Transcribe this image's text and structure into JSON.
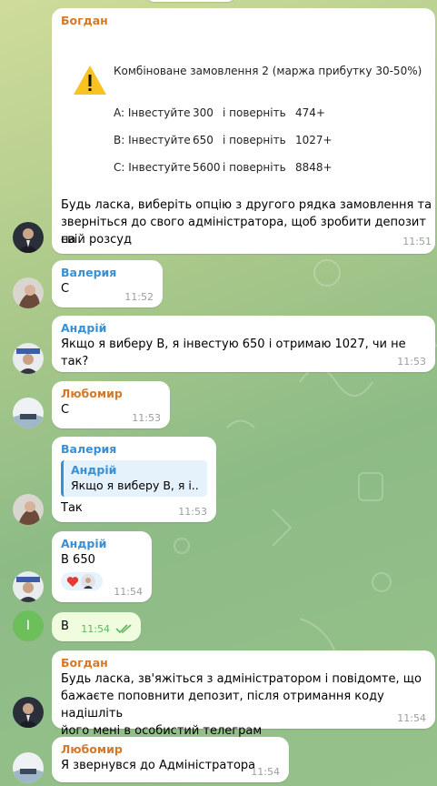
{
  "colors": {
    "bogdan": "#d27a2a",
    "valeria": "#3a8fd2",
    "andriy": "#3a8fd2",
    "lubomyr": "#d27a2a",
    "check": "#61b55d"
  },
  "m1": {
    "sender": "Богдан",
    "offer_title": "Комбіноване замовлення 2 (маржа прибутку 30-50%)",
    "rows": [
      {
        "a": "A: Інвестуйте",
        "b": "300",
        "c": "і поверніть",
        "d": "474+"
      },
      {
        "a": "B: Інвестуйте",
        "b": "650",
        "c": "і поверніть",
        "d": "1027+"
      },
      {
        "a": "C: Інвестуйте",
        "b": "5600",
        "c": "і поверніть",
        "d": "8848+"
      }
    ],
    "text_1": "Будь ласка, виберіть опцію з другого рядка замовлення та",
    "text_2": "зверніться до свого адміністратора, щоб зробити депозит на",
    "text_3": "свій розсуд",
    "time": "11:51"
  },
  "m2": {
    "sender": "Валерия",
    "text": "С",
    "time": "11:52"
  },
  "m3": {
    "sender": "Андрій",
    "text": "Якщо я виберу В, я інвестую 650 і отримаю 1027, чи не так?",
    "time": "11:53"
  },
  "m4": {
    "sender": "Любомир",
    "text": "С",
    "time": "11:53"
  },
  "m5": {
    "sender": "Валерия",
    "reply_name": "Андрій",
    "reply_text": "Якщо я виберу В, я і...",
    "text": "Так",
    "time": "11:53"
  },
  "m6": {
    "sender": "Андрій",
    "text": "В 650",
    "time": "11:54"
  },
  "m7": {
    "avatar_letter": "I",
    "text": "B",
    "time": "11:54"
  },
  "m8": {
    "sender": "Богдан",
    "text_1": "Будь ласка, зв'яжіться з адміністратором і повідомте, що",
    "text_2": "бажаєте поповнити депозит, після отримання коду надішліть",
    "text_3": "його мені в особистий телеграм",
    "time": "11:54"
  },
  "m9": {
    "sender": "Любомир",
    "text": "Я звернувся до Адміністратора",
    "time": "11:54"
  }
}
